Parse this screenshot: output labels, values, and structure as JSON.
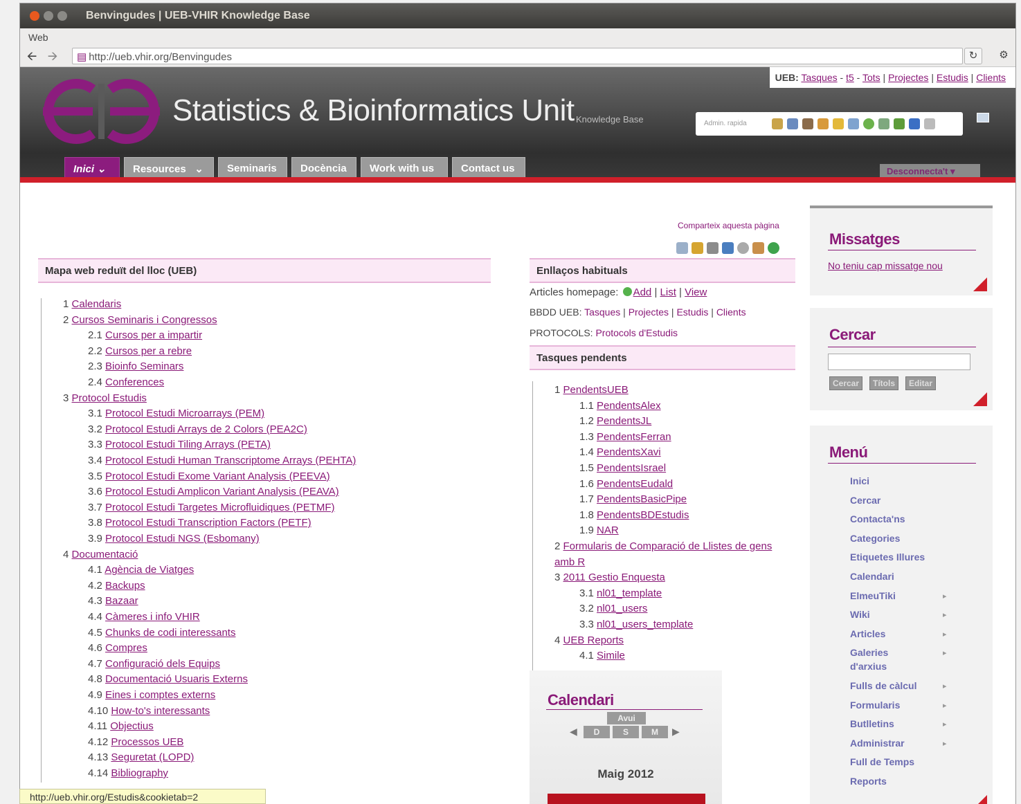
{
  "window": {
    "title": "Benvingudes | UEB-VHIR Knowledge Base",
    "menu": "Web"
  },
  "browser": {
    "url": "http://ueb.vhir.org/Benvingudes",
    "reload_icon": "reload-icon",
    "settings_icon": "gear-icon"
  },
  "ueb_bar": {
    "label": "UEB:",
    "links": [
      "Tasques",
      "t5",
      "Tots",
      "Projectes",
      "Estudis",
      "Clients"
    ]
  },
  "header": {
    "title": "Statistics & Bioinformatics Unit",
    "subtitle": "Knowledge Base",
    "admin_label": "Admin. rapida",
    "logout": "Desconnecta't"
  },
  "tabs": [
    {
      "label": "Inici",
      "caret": "⌄"
    },
    {
      "label": "Resources",
      "caret": "⌄"
    },
    {
      "label": "Seminaris"
    },
    {
      "label": "Docència"
    },
    {
      "label": "Work with us"
    },
    {
      "label": "Contact us"
    }
  ],
  "share": {
    "label": "Comparteix aquesta pàgina"
  },
  "sitemap": {
    "title": "Mapa web reduït del lloc (UEB)",
    "items": [
      {
        "num": "1",
        "text": "Calendaris",
        "level": 1
      },
      {
        "num": "2",
        "text": "Cursos Seminaris i Congressos",
        "level": 1
      },
      {
        "num": "2.1",
        "text": "Cursos per a impartir",
        "level": 2
      },
      {
        "num": "2.2",
        "text": "Cursos per a rebre",
        "level": 2
      },
      {
        "num": "2.3",
        "text": "Bioinfo Seminars",
        "level": 2
      },
      {
        "num": "2.4",
        "text": "Conferences",
        "level": 2
      },
      {
        "num": "3",
        "text": "Protocol Estudis",
        "level": 1
      },
      {
        "num": "3.1",
        "text": "Protocol Estudi Microarrays (PEM)",
        "level": 2
      },
      {
        "num": "3.2",
        "text": "Protocol Estudi Arrays de 2 Colors (PEA2C)",
        "level": 2
      },
      {
        "num": "3.3",
        "text": "Protocol Estudi Tiling Arrays (PETA)",
        "level": 2
      },
      {
        "num": "3.4",
        "text": "Protocol Estudi Human Transcriptome Arrays (PEHTA)",
        "level": 2
      },
      {
        "num": "3.5",
        "text": "Protocol Estudi Exome Variant Analysis (PEEVA)",
        "level": 2
      },
      {
        "num": "3.6",
        "text": "Protocol Estudi Amplicon Variant Analysis (PEAVA)",
        "level": 2
      },
      {
        "num": "3.7",
        "text": "Protocol Estudi Targetes Microfluidiques (PETMF)",
        "level": 2
      },
      {
        "num": "3.8",
        "text": "Protocol Estudi Transcription Factors (PETF)",
        "level": 2
      },
      {
        "num": "3.9",
        "text": "Protocol Estudi NGS (Esbomany)",
        "level": 2
      },
      {
        "num": "4",
        "text": "Documentació",
        "level": 1
      },
      {
        "num": "4.1",
        "text": "Agència de Viatges",
        "level": 2
      },
      {
        "num": "4.2",
        "text": "Backups",
        "level": 2
      },
      {
        "num": "4.3",
        "text": "Bazaar",
        "level": 2
      },
      {
        "num": "4.4",
        "text": "Càmeres i info VHIR",
        "level": 2
      },
      {
        "num": "4.5",
        "text": "Chunks de codi interessants",
        "level": 2
      },
      {
        "num": "4.6",
        "text": "Compres",
        "level": 2
      },
      {
        "num": "4.7",
        "text": "Configuració dels Equips",
        "level": 2
      },
      {
        "num": "4.8",
        "text": "Documentació Usuaris Externs",
        "level": 2
      },
      {
        "num": "4.9",
        "text": "Eines i comptes externs",
        "level": 2
      },
      {
        "num": "4.10",
        "text": "How-to's interessants",
        "level": 2
      },
      {
        "num": "4.11",
        "text": "Objectius",
        "level": 2
      },
      {
        "num": "4.12",
        "text": "Processos UEB",
        "level": 2
      },
      {
        "num": "4.13",
        "text": "Seguretat (LOPD)",
        "level": 2
      },
      {
        "num": "4.14",
        "text": "Bibliography",
        "level": 2
      }
    ]
  },
  "enllacos": {
    "title": "Enllaços habituals",
    "articles_label": "Articles homepage:",
    "articles_links": [
      "Add",
      "List",
      "View"
    ],
    "bbdd_label": "BBDD UEB:",
    "bbdd_links": [
      "Tasques",
      "Projectes",
      "Estudis",
      "Clients"
    ],
    "protocols_label": "PROTOCOLS:",
    "protocols_link": "Protocols d'Estudis"
  },
  "tasques": {
    "title": "Tasques pendents",
    "items": [
      {
        "num": "1",
        "text": "PendentsUEB",
        "level": 1
      },
      {
        "num": "1.1",
        "text": "PendentsAlex",
        "level": 2
      },
      {
        "num": "1.2",
        "text": "PendentsJL",
        "level": 2
      },
      {
        "num": "1.3",
        "text": "PendentsFerran",
        "level": 2
      },
      {
        "num": "1.4",
        "text": "PendentsXavi",
        "level": 2
      },
      {
        "num": "1.5",
        "text": "PendentsIsrael",
        "level": 2
      },
      {
        "num": "1.6",
        "text": "PendentsEudald",
        "level": 2
      },
      {
        "num": "1.7",
        "text": "PendentsBasicPipe",
        "level": 2
      },
      {
        "num": "1.8",
        "text": "PendentsBDEstudis",
        "level": 2
      },
      {
        "num": "1.9",
        "text": "NAR",
        "level": 2
      },
      {
        "num": "2",
        "text": "Formularis de Comparació de Llistes de gens",
        "text2": "amb R",
        "level": 1
      },
      {
        "num": "3",
        "text": "2011 Gestio Enquesta",
        "level": 1
      },
      {
        "num": "3.1",
        "text": "nl01_template",
        "level": 2
      },
      {
        "num": "3.2",
        "text": "nl01_users",
        "level": 2
      },
      {
        "num": "3.3",
        "text": "nl01_users_template",
        "level": 2
      },
      {
        "num": "4",
        "text": "UEB Reports",
        "level": 1
      },
      {
        "num": "4.1",
        "text": "Simile",
        "level": 2
      }
    ]
  },
  "calendari": {
    "title": "Calendari",
    "view": "Avui",
    "buttons": [
      "D",
      "S",
      "M"
    ],
    "month": "Maig 2012"
  },
  "missatges": {
    "title": "Missatges",
    "text": "No teniu cap missatge nou"
  },
  "cercar": {
    "title": "Cercar",
    "buttons": [
      "Cercar",
      "Títols",
      "Editar"
    ]
  },
  "menu": {
    "title": "Menú",
    "items": [
      {
        "label": "Inici",
        "sub": false
      },
      {
        "label": "Cercar",
        "sub": false
      },
      {
        "label": "Contacta'ns",
        "sub": false
      },
      {
        "label": "Categories",
        "sub": false
      },
      {
        "label": "Etiquetes Illures",
        "sub": false
      },
      {
        "label": "Calendari",
        "sub": false
      },
      {
        "label": "ElmeuTiki",
        "sub": true
      },
      {
        "label": "Wiki",
        "sub": true
      },
      {
        "label": "Articles",
        "sub": true
      },
      {
        "label": "Galeries",
        "label2": "d'arxius",
        "sub": true
      },
      {
        "label": "Fulls de càlcul",
        "sub": true
      },
      {
        "label": "Formularis",
        "sub": true
      },
      {
        "label": "Butlletins",
        "sub": true
      },
      {
        "label": "Administrar",
        "sub": true
      },
      {
        "label": "Full de Temps",
        "sub": false
      },
      {
        "label": "Reports",
        "sub": false
      }
    ]
  },
  "statusbar": {
    "text": "http://ueb.vhir.org/Estudis&cookietab=2"
  },
  "colors": {
    "accent": "#8a1a78",
    "red": "#d01f2a"
  }
}
